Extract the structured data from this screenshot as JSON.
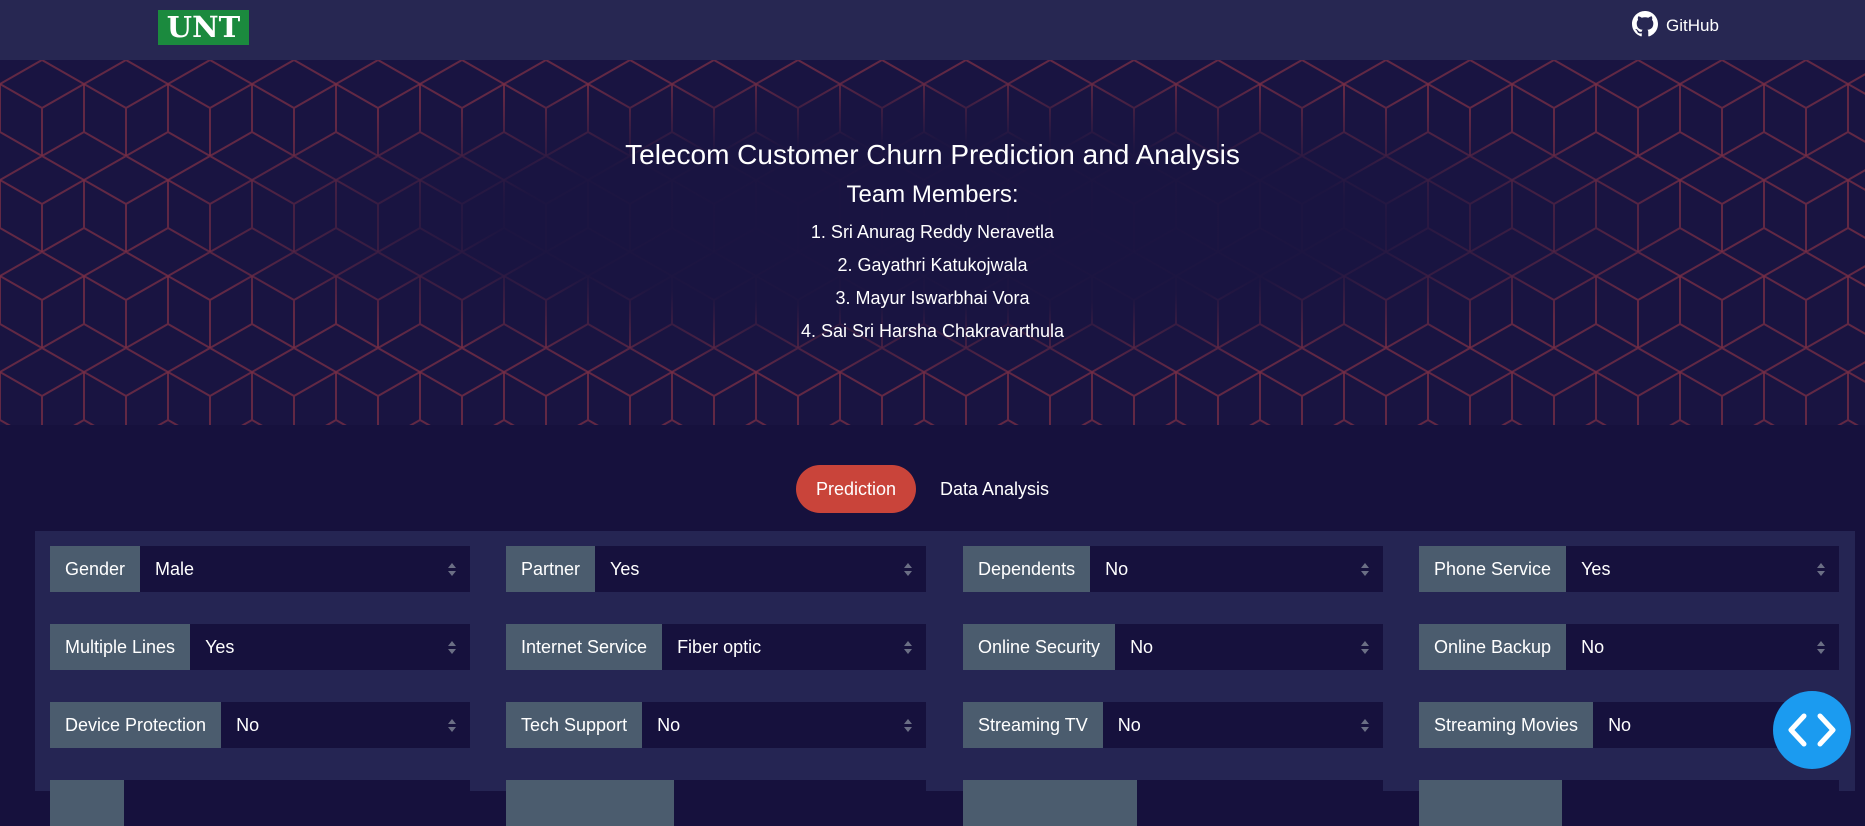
{
  "navbar": {
    "logo_text": "UNT",
    "github_label": "GitHub"
  },
  "hero": {
    "title": "Telecom Customer Churn Prediction and Analysis",
    "team_heading": "Team Members:",
    "members": [
      "1. Sri Anurag Reddy Neravetla",
      "2. Gayathri Katukojwala",
      "3. Mayur Iswarbhai Vora",
      "4. Sai Sri Harsha Chakravarthula"
    ]
  },
  "tabs": [
    {
      "label": "Prediction",
      "active": true
    },
    {
      "label": "Data Analysis",
      "active": false
    }
  ],
  "form": {
    "fields": [
      {
        "label": "Gender",
        "value": "Male"
      },
      {
        "label": "Partner",
        "value": "Yes"
      },
      {
        "label": "Dependents",
        "value": "No"
      },
      {
        "label": "Phone Service",
        "value": "Yes"
      },
      {
        "label": "Multiple Lines",
        "value": "Yes"
      },
      {
        "label": "Internet Service",
        "value": "Fiber optic"
      },
      {
        "label": "Online Security",
        "value": "No"
      },
      {
        "label": "Online Backup",
        "value": "No"
      },
      {
        "label": "Device Protection",
        "value": "No"
      },
      {
        "label": "Tech Support",
        "value": "No"
      },
      {
        "label": "Streaming TV",
        "value": "No"
      },
      {
        "label": "Streaming Movies",
        "value": "No"
      }
    ]
  },
  "colors": {
    "page_bg": "#16113d",
    "navbar_bg": "#272752",
    "accent_active_tab": "#c9443a",
    "field_label_bg": "#4b5c6e",
    "fab_bg": "#1b9bf0",
    "logo_green": "#1b8a3e"
  },
  "icons": {
    "github": "github-icon",
    "select_arrows": "sort-arrows-icon",
    "fab": "code-brackets-icon"
  }
}
